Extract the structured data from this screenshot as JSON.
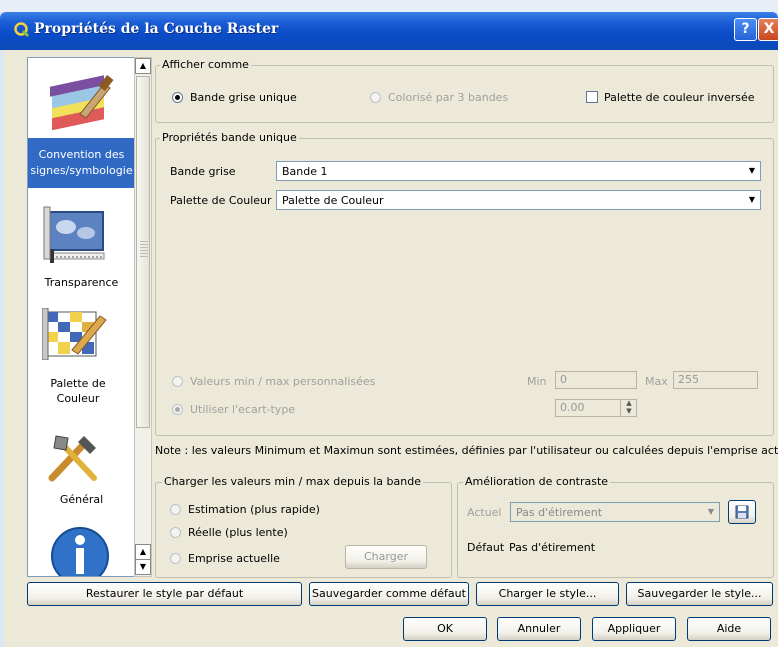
{
  "window": {
    "title": "Propriétés de la Couche Raster",
    "help": "?",
    "close": "X"
  },
  "sidebar": {
    "items": [
      {
        "label": "Convention des signes/symbologie",
        "icon": "symbology-icon"
      },
      {
        "label": "Transparence",
        "icon": "transparency-icon"
      },
      {
        "label": "Palette de Couleur",
        "icon": "colormap-icon"
      },
      {
        "label": "Général",
        "icon": "general-tools-icon"
      },
      {
        "label": "",
        "icon": "info-icon"
      }
    ]
  },
  "afficher": {
    "title": "Afficher comme",
    "single": "Bande grise unique",
    "three": "Colorisé par 3 bandes",
    "invert": "Palette de couleur inversée"
  },
  "bande": {
    "title": "Propriétés bande unique",
    "gris_label": "Bande grise",
    "gris_value": "Bande 1",
    "palette_label": "Palette de Couleur",
    "palette_value": "Palette de Couleur",
    "custom": "Valeurs min / max personnalisées",
    "min_label": "Min",
    "min_value": "0",
    "max_label": "Max",
    "max_value": "255",
    "stddev": "Utiliser l'ecart-type",
    "stddev_value": "0.00"
  },
  "note": "Note : les valeurs Minimum et Maximun sont estimées, définies par l'utilisateur ou calculées depuis l'emprise actuelle",
  "charger": {
    "title": "Charger les valeurs min / max depuis la bande",
    "estimation": "Estimation (plus rapide)",
    "reelle": "Réelle (plus lente)",
    "emprise": "Emprise actuelle",
    "button": "Charger"
  },
  "contraste": {
    "title": "Amélioration de contraste",
    "actuel_label": "Actuel",
    "actuel_value": "Pas d'étirement",
    "defaut_label": "Défaut",
    "defaut_value": "Pas d'étirement"
  },
  "style_buttons": {
    "restore": "Restaurer le style par défaut",
    "save_default": "Sauvegarder comme défaut",
    "load": "Charger le style...",
    "save": "Sauvegarder le style..."
  },
  "dialog_buttons": {
    "ok": "OK",
    "cancel": "Annuler",
    "apply": "Appliquer",
    "help": "Aide"
  }
}
